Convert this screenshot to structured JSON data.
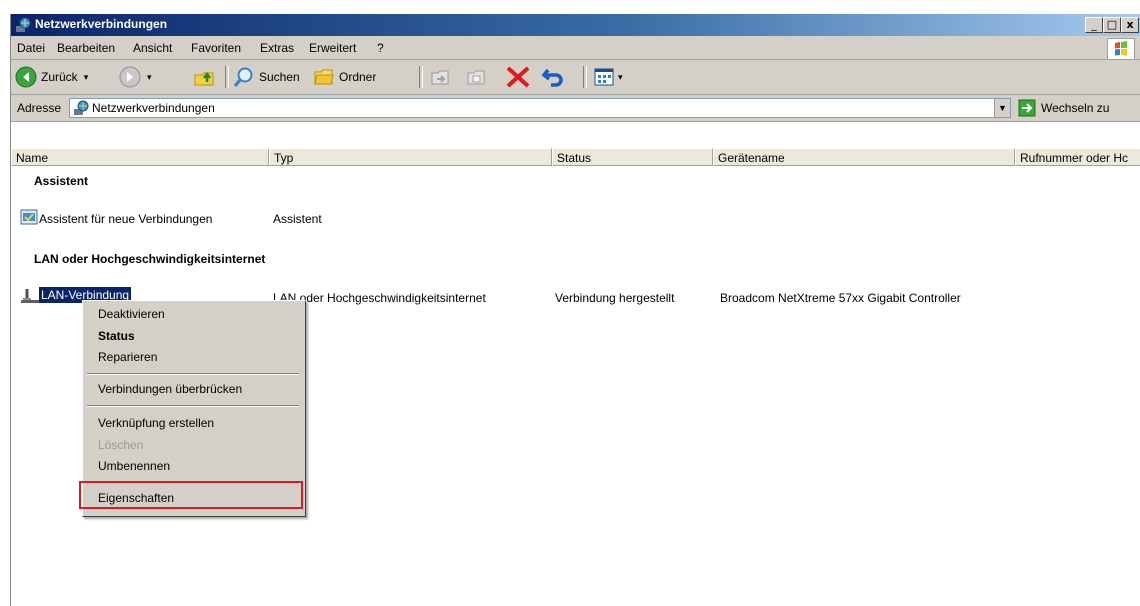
{
  "window": {
    "title": "Netzwerkverbindungen",
    "minimize": "_",
    "maximize": "□",
    "close": "x"
  },
  "menubar": {
    "items": [
      "Datei",
      "Bearbeiten",
      "Ansicht",
      "Favoriten",
      "Extras",
      "Erweitert",
      "?"
    ]
  },
  "toolbar": {
    "back_label": "Zurück",
    "search_label": "Suchen",
    "folders_label": "Ordner"
  },
  "address": {
    "label": "Adresse",
    "value": "Netzwerkverbindungen",
    "go_label": "Wechseln zu"
  },
  "columns": [
    "Name",
    "Typ",
    "Status",
    "Gerätename",
    "Rufnummer oder Hc"
  ],
  "groups": [
    {
      "title": "Assistent",
      "items": [
        {
          "name": "Assistent für neue Verbindungen",
          "type": "Assistent",
          "status": "",
          "device": ""
        }
      ]
    },
    {
      "title": "LAN oder Hochgeschwindigkeitsinternet",
      "items": [
        {
          "name": "LAN-Verbindung",
          "type": "LAN oder Hochgeschwindigkeitsinternet",
          "status": "Verbindung hergestellt",
          "device": "Broadcom NetXtreme 57xx Gigabit Controller"
        }
      ]
    }
  ],
  "context_menu": {
    "items": [
      {
        "label": "Deaktivieren",
        "bold": false,
        "disabled": false
      },
      {
        "label": "Status",
        "bold": true,
        "disabled": false
      },
      {
        "label": "Reparieren",
        "bold": false,
        "disabled": false
      },
      {
        "label": "Verbindungen überbrücken",
        "bold": false,
        "disabled": false
      },
      {
        "label": "Verknüpfung erstellen",
        "bold": false,
        "disabled": false
      },
      {
        "label": "Löschen",
        "bold": false,
        "disabled": true
      },
      {
        "label": "Umbenennen",
        "bold": false,
        "disabled": false
      },
      {
        "label": "Eigenschaften",
        "bold": false,
        "disabled": false
      }
    ]
  },
  "colors": {
    "titlebar_start": "#0a246a",
    "titlebar_end": "#a6caf0",
    "selection": "#0a246a",
    "highlight_box": "#e01a1a",
    "disabled_text": "#9a9a9a"
  }
}
